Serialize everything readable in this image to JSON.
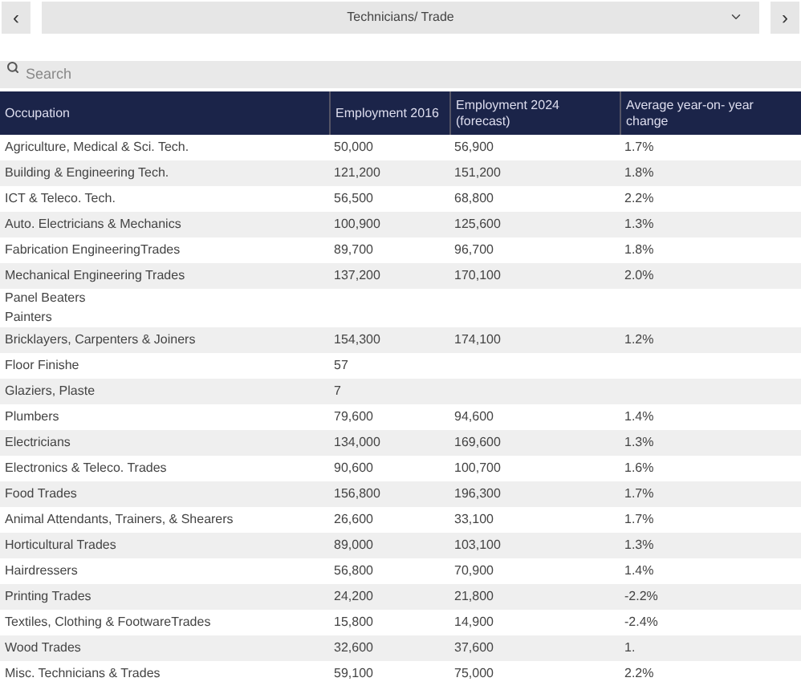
{
  "nav": {
    "prev": "‹",
    "category": "Technicians/ Trade",
    "next": "›"
  },
  "search": {
    "placeholder": "Search"
  },
  "table": {
    "columns": [
      "Occupation",
      "Employment 2016",
      "Employment 2024 (forecast)",
      "Average year-on- year change"
    ],
    "rows": [
      {
        "cells": [
          "Agriculture, Medical & Sci. Tech.",
          "50,000",
          "56,900",
          "1.7%"
        ]
      },
      {
        "cells": [
          "Building & Engineering Tech.",
          "121,200",
          "151,200",
          "1.8%"
        ]
      },
      {
        "cells": [
          "ICT & Teleco. Tech.",
          "56,500",
          "68,800",
          "2.2%"
        ]
      },
      {
        "cells": [
          "Auto. Electricians & Mechanics",
          "100,900",
          "125,600",
          "1.3%"
        ]
      },
      {
        "cells": [
          "Fabrication EngineeringTrades",
          "89,700",
          "96,700",
          "1.8%"
        ]
      },
      {
        "cells": [
          "Mechanical Engineering Trades",
          "137,200",
          "170,100",
          "2.0%"
        ]
      },
      {
        "cells": [
          "Panel Beaters\nPainters"
        ]
      },
      {
        "cells": [
          "Bricklayers, Carpenters & Joiners",
          "154,300",
          "174,100",
          "1.2%"
        ]
      },
      {
        "cells": [
          "Floor Finishe",
          "57"
        ]
      },
      {
        "cells": [
          "Glaziers, Plaste",
          "7"
        ]
      },
      {
        "cells": [
          "Plumbers",
          "79,600",
          "94,600",
          "1.4%"
        ]
      },
      {
        "cells": [
          "Electricians",
          "134,000",
          "169,600",
          "1.3%"
        ]
      },
      {
        "cells": [
          "Electronics & Teleco. Trades",
          "90,600",
          "100,700",
          "1.6%"
        ]
      },
      {
        "cells": [
          "Food Trades",
          "156,800",
          "196,300",
          "1.7%"
        ]
      },
      {
        "cells": [
          "Animal Attendants, Trainers, & Shearers",
          "26,600",
          "33,100",
          "1.7%"
        ]
      },
      {
        "cells": [
          "Horticultural Trades",
          "89,000",
          "103,100",
          "1.3%"
        ]
      },
      {
        "cells": [
          "Hairdressers",
          "56,800",
          "70,900",
          "1.4%"
        ]
      },
      {
        "cells": [
          "Printing Trades",
          "24,200",
          "21,800",
          "-2.2%"
        ]
      },
      {
        "cells": [
          "Textiles, Clothing & FootwareTrades",
          "15,800",
          "14,900",
          "-2.4%"
        ]
      },
      {
        "cells": [
          "Wood Trades",
          "32,600",
          "37,600",
          "1."
        ]
      },
      {
        "cells": [
          "Misc. Technicians & Trades",
          "59,100",
          "75,000",
          "2.2%"
        ]
      }
    ]
  }
}
